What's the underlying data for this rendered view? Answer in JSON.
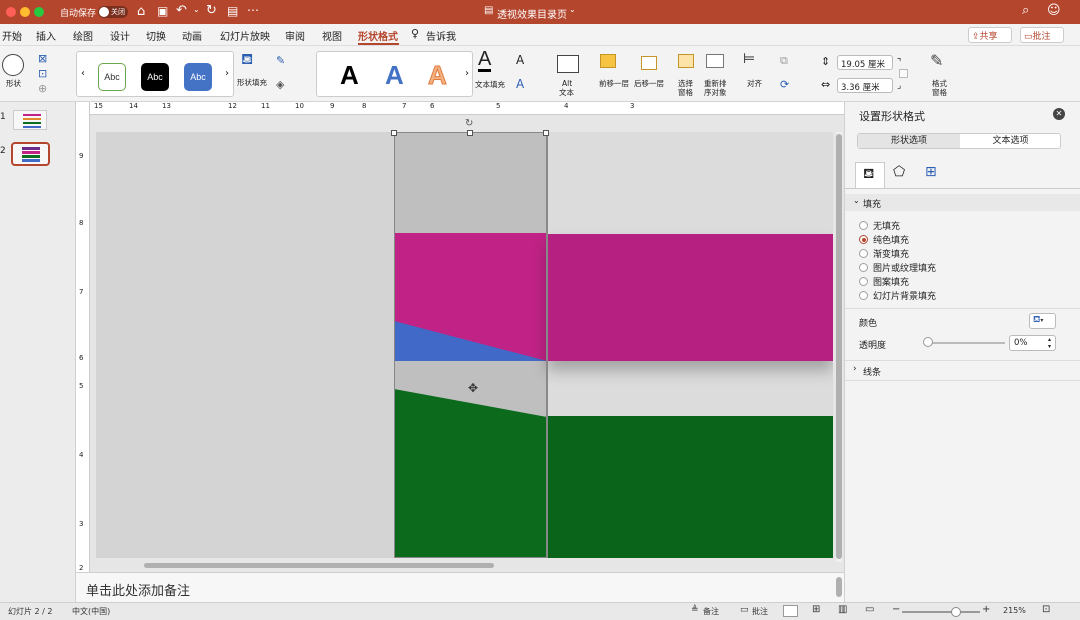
{
  "titlebar": {
    "autosave_label": "自动保存",
    "autosave_state": "关闭",
    "doc_title": "透视效果目录页"
  },
  "ribbon_tabs": [
    "开始",
    "插入",
    "绘图",
    "设计",
    "切换",
    "动画",
    "幻灯片放映",
    "审阅",
    "视图",
    "形状格式",
    "告诉我"
  ],
  "active_tab": "形状格式",
  "share_label": "共享",
  "comments_label": "批注",
  "toolbar": {
    "shapes_label": "形状",
    "style_samples": [
      "Abc",
      "Abc",
      "Abc"
    ],
    "shape_fill_label": "形状填充",
    "wordart_letters": [
      "A",
      "A",
      "A"
    ],
    "text_fill_label": "文本填充",
    "alt_text_label_1": "Alt",
    "alt_text_label_2": "文本",
    "bring_forward_label": "前移一层",
    "send_backward_label": "后移一层",
    "selection_pane_label_1": "选择",
    "selection_pane_label_2": "窗格",
    "reorder_label_1": "重新排",
    "reorder_label_2": "序对象",
    "align_label": "对齐",
    "height_value": "19.05 厘米",
    "width_value": "3.36 厘米",
    "format_pane_label_1": "格式",
    "format_pane_label_2": "窗格"
  },
  "slides": [
    {
      "number": "1"
    },
    {
      "number": "2"
    }
  ],
  "ruler_labels": [
    "15",
    "14",
    "13",
    "12",
    "11",
    "10",
    "9",
    "8",
    "7",
    "6",
    "5",
    "4",
    "3"
  ],
  "vruler_labels": [
    "9",
    "8",
    "7",
    "6",
    "5",
    "4",
    "3",
    "2"
  ],
  "notes_placeholder": "单击此处添加备注",
  "format_panel": {
    "title": "设置形状格式",
    "tab_shape": "形状选项",
    "tab_text": "文本选项",
    "fill_section": "填充",
    "fill_options": [
      "无填充",
      "纯色填充",
      "渐变填充",
      "图片或纹理填充",
      "图案填充",
      "幻灯片背景填充"
    ],
    "selected_fill": "纯色填充",
    "color_label": "颜色",
    "transparency_label": "透明度",
    "transparency_value": "0%",
    "transparency_fraction": 0,
    "line_section": "线条"
  },
  "status": {
    "slide_info": "幻灯片 2 / 2",
    "language": "中文(中国)",
    "notes_btn": "备注",
    "comments_btn": "批注",
    "zoom": "215%",
    "zoom_fraction": 0.7
  },
  "colors": {
    "accent": "#b5462e",
    "magenta": "#c02385",
    "green": "#0a6e1d",
    "blue": "#4169c8"
  }
}
